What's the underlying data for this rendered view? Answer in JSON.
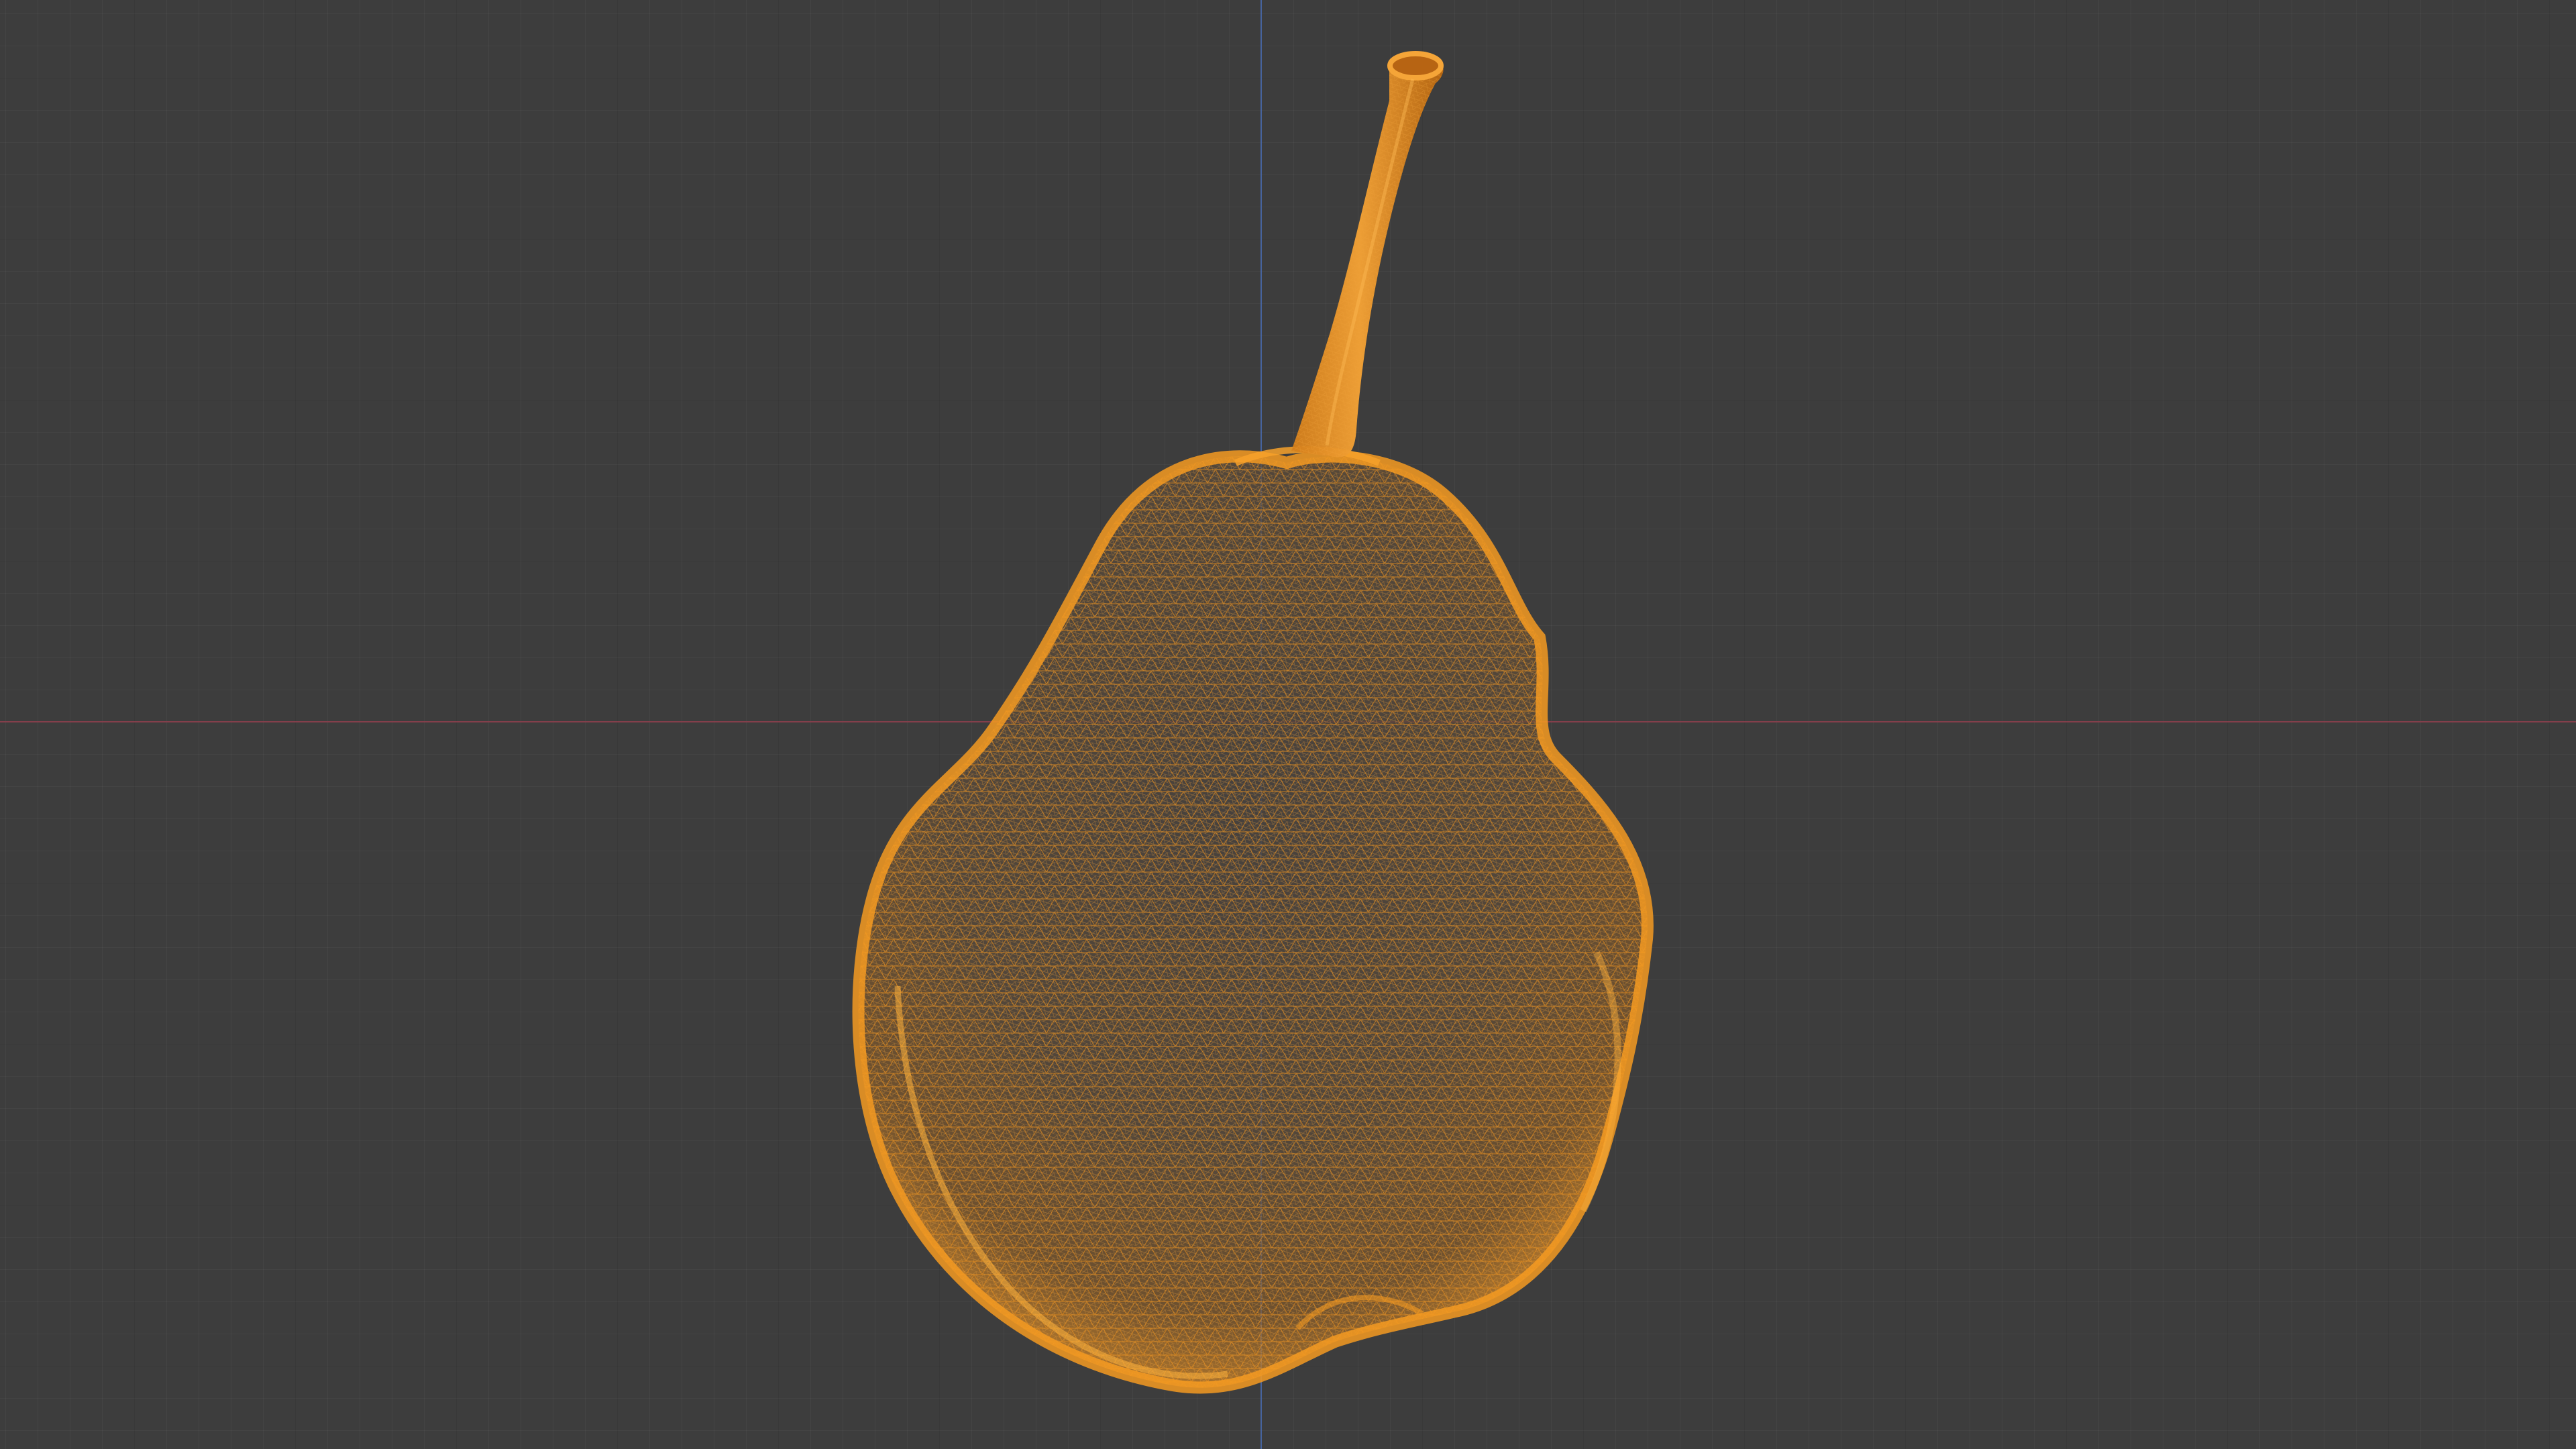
{
  "scene": {
    "background_color": "#3d3d3d",
    "grid_minor_color": "#474747",
    "grid_major_color": "#2f2f2f",
    "x_axis_color": "#8b3f4c",
    "y_axis_color": "#4868a8",
    "selected_object": {
      "name": "",
      "display_mode": "wireframe",
      "wire_color": "#f39a22",
      "fill_color": "#3a3632"
    }
  }
}
